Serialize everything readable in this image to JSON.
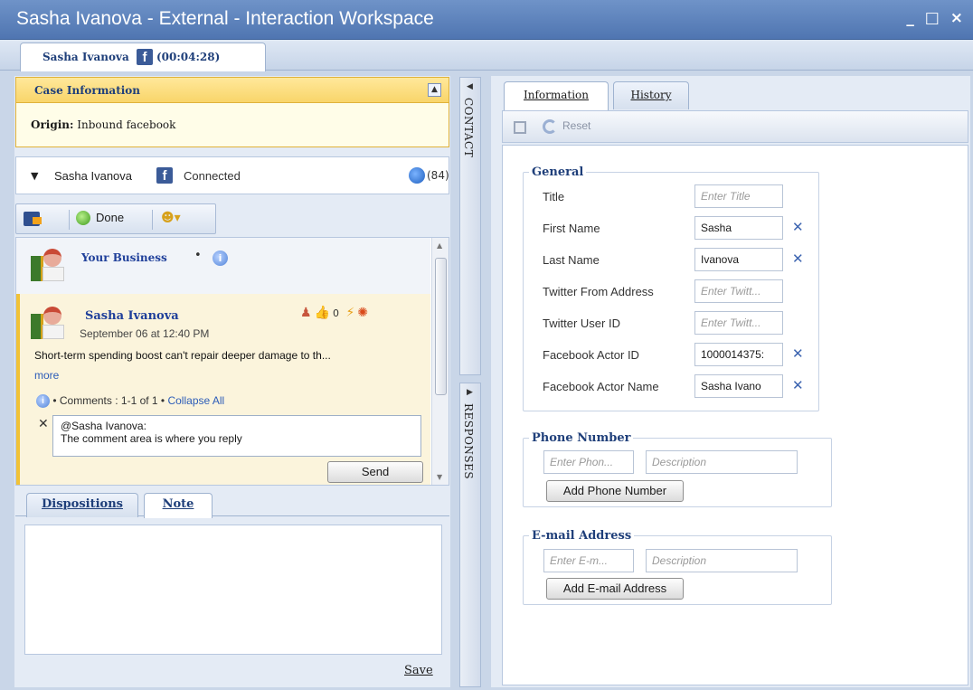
{
  "window": {
    "title": "Sasha Ivanova - External - Interaction Workspace",
    "controls": "_ □ ×"
  },
  "session_tab": {
    "name": "Sasha Ivanova",
    "channel_icon": "f",
    "duration": "(00:04:28)"
  },
  "case_info": {
    "header": "Case Information",
    "origin_label": "Origin:",
    "origin_value": "Inbound facebook"
  },
  "party": {
    "name": "Sasha Ivanova",
    "status": "Connected",
    "count": "(84)"
  },
  "toolbar": {
    "done_label": "Done"
  },
  "feed": {
    "business_name": "Your Business",
    "business_sep": "•",
    "post": {
      "author": "Sasha Ivanova",
      "date": "September 06 at 12:40 PM",
      "likes": "0",
      "message": "Short-term spending boost can't repair deeper damage to th...",
      "more": "more",
      "comments_text": "• Comments : 1-1 of 1 •",
      "collapse_all": "Collapse All",
      "reply_author": "@Sasha Ivanova:",
      "reply_text": "The comment area is where you reply",
      "send_label": "Send"
    }
  },
  "bottom_tabs": {
    "dispositions": "Dispositions",
    "note": "Note",
    "save": "Save"
  },
  "rails": {
    "contact": "CONTACT",
    "responses": "RESPONSES"
  },
  "right_tabs": {
    "information": "Information",
    "history": "History"
  },
  "right_toolbar": {
    "reset": "Reset"
  },
  "general": {
    "legend": "General",
    "fields": [
      {
        "label": "Title",
        "value": "",
        "placeholder": "Enter Title"
      },
      {
        "label": "First Name",
        "value": "Sasha",
        "placeholder": ""
      },
      {
        "label": "Last Name",
        "value": "Ivanova",
        "placeholder": ""
      },
      {
        "label": "Twitter From Address",
        "value": "",
        "placeholder": "Enter Twitt..."
      },
      {
        "label": "Twitter User ID",
        "value": "",
        "placeholder": "Enter Twitt..."
      },
      {
        "label": "Facebook Actor ID",
        "value": "1000014375:",
        "placeholder": ""
      },
      {
        "label": "Facebook Actor Name",
        "value": "Sasha Ivano",
        "placeholder": ""
      }
    ]
  },
  "phone": {
    "legend": "Phone Number",
    "ph_number": "Enter Phon...",
    "ph_desc": "Description",
    "add_label": "Add Phone Number"
  },
  "email": {
    "legend": "E-mail Address",
    "ph_address": "Enter E-m...",
    "ph_desc": "Description",
    "add_label": "Add E-mail Address"
  }
}
